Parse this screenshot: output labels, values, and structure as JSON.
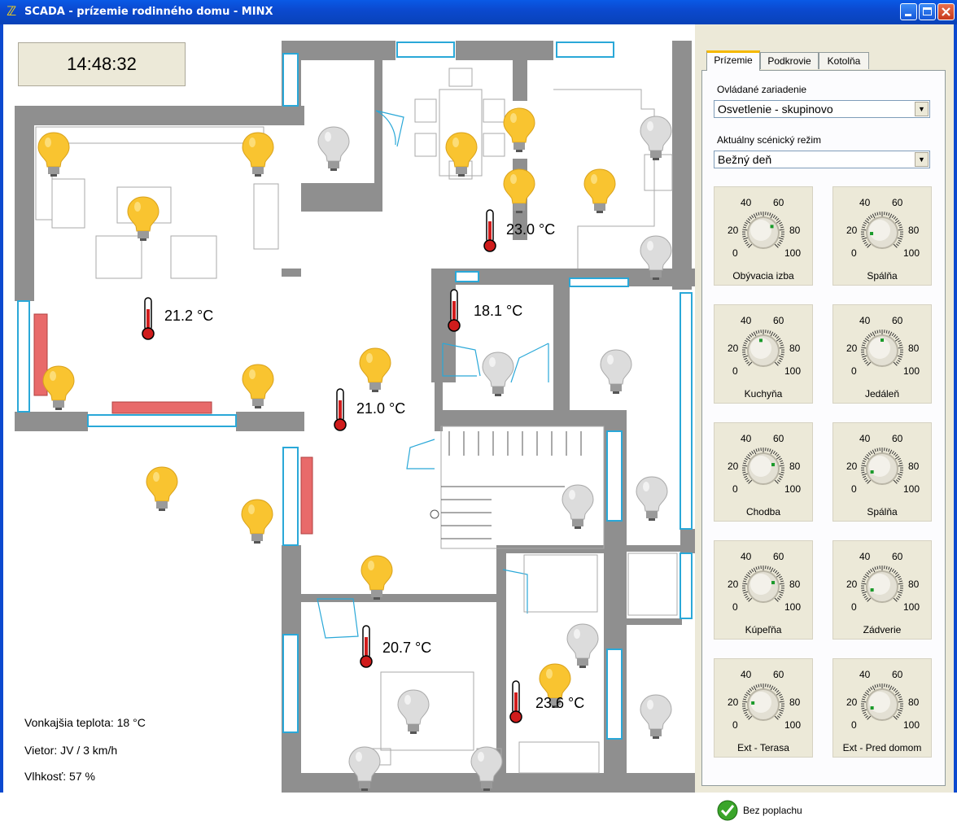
{
  "window": {
    "title": "SCADA - prízemie rodinného domu - MINX"
  },
  "clock": "14:48:32",
  "weather": {
    "outside_temp": "Vonkajšia teplota: 18 °C",
    "wind": "Vietor: JV / 3 km/h",
    "humidity": "Vlhkosť: 57 %"
  },
  "temperatures": [
    "21.2 °C",
    "23.0 °C",
    "18.1 °C",
    "21.0 °C",
    "20.7 °C",
    "23.6 °C"
  ],
  "tabs": [
    "Prízemie",
    "Podkrovie",
    "Kotolňa"
  ],
  "controls": {
    "device_label": "Ovládané zariadenie",
    "device_value": "Osvetlenie - skupinovo",
    "scene_label": "Aktuálny scénický režim",
    "scene_value": "Bežný deň"
  },
  "dial_scale": {
    "t40": "40",
    "t60": "60",
    "t20": "20",
    "t80": "80",
    "t0": "0",
    "t100": "100"
  },
  "dials": [
    {
      "name": "Obývacia izba",
      "value": 70
    },
    {
      "name": "Spálňa",
      "value": 15
    },
    {
      "name": "Kuchyňa",
      "value": 45
    },
    {
      "name": "Jedáleň",
      "value": 50
    },
    {
      "name": "Chodba",
      "value": 75
    },
    {
      "name": "Spálňa",
      "value": 10
    },
    {
      "name": "Kúpeľňa",
      "value": 75
    },
    {
      "name": "Zádverie",
      "value": 10
    },
    {
      "name": "Ext - Terasa",
      "value": 20
    },
    {
      "name": "Ext - Pred domom",
      "value": 10
    }
  ],
  "alarm": "Bez poplachu",
  "colors": {
    "bulb_on": "#f9c430",
    "bulb_off": "#d4d4d4",
    "wall": "#8f8f8f",
    "window": "#2aa8d8",
    "radiator": "#e86a6a",
    "accent": "#f5b900"
  }
}
